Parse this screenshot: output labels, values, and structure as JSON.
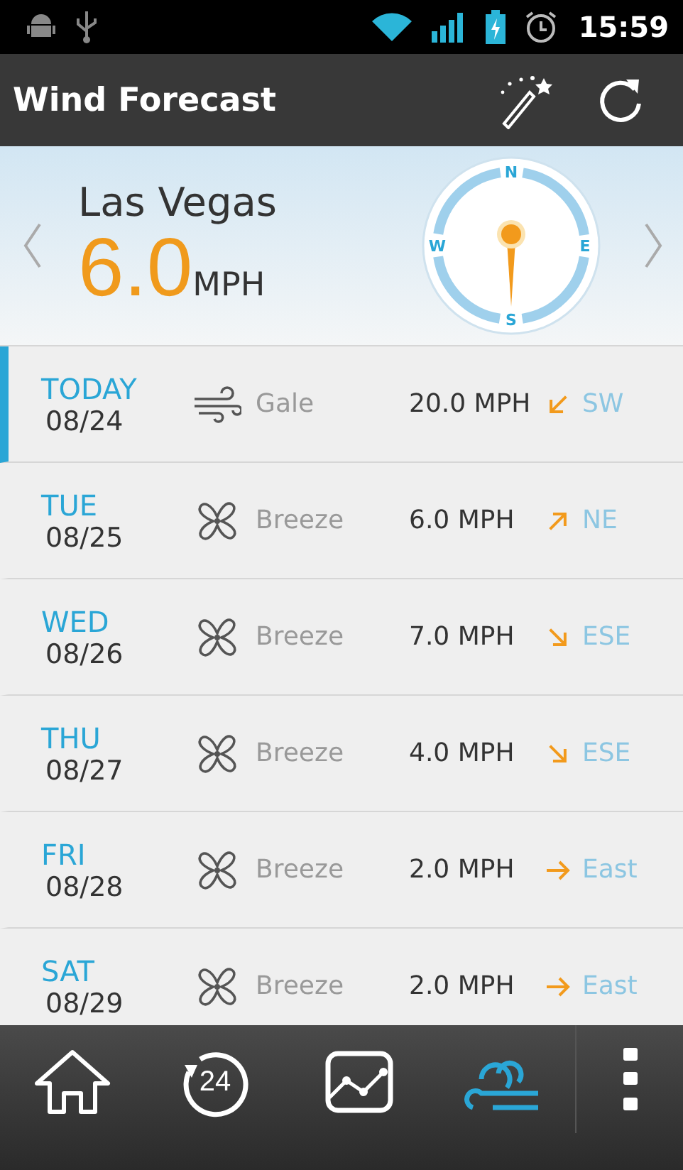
{
  "status_bar": {
    "time": "15:59"
  },
  "app_bar": {
    "title": "Wind Forecast"
  },
  "current": {
    "city": "Las Vegas",
    "speed": "6.0",
    "unit": "MPH",
    "compass": {
      "north": "N",
      "east": "E",
      "south": "S",
      "west": "W"
    }
  },
  "days": [
    {
      "day": "TODAY",
      "date": "08/24",
      "kind": "gale",
      "condition": "Gale",
      "speed": "20.0 MPH",
      "arrow": {
        "kind": "down-left"
      },
      "direction": "SW",
      "selected": true
    },
    {
      "day": "TUE",
      "date": "08/25",
      "kind": "breeze",
      "condition": "Breeze",
      "speed": "6.0 MPH",
      "arrow": {
        "kind": "up-right"
      },
      "direction": "NE",
      "selected": false
    },
    {
      "day": "WED",
      "date": "08/26",
      "kind": "breeze",
      "condition": "Breeze",
      "speed": "7.0 MPH",
      "arrow": {
        "kind": "down-right"
      },
      "direction": "ESE",
      "selected": false
    },
    {
      "day": "THU",
      "date": "08/27",
      "kind": "breeze",
      "condition": "Breeze",
      "speed": "4.0 MPH",
      "arrow": {
        "kind": "down-right"
      },
      "direction": "ESE",
      "selected": false
    },
    {
      "day": "FRI",
      "date": "08/28",
      "kind": "breeze",
      "condition": "Breeze",
      "speed": "2.0 MPH",
      "arrow": {
        "kind": "right"
      },
      "direction": "East",
      "selected": false
    },
    {
      "day": "SAT",
      "date": "08/29",
      "kind": "breeze",
      "condition": "Breeze",
      "speed": "2.0 MPH",
      "arrow": {
        "kind": "right"
      },
      "direction": "East",
      "selected": false
    }
  ],
  "nav": [
    {
      "kind": "home",
      "selected": false
    },
    {
      "kind": "history",
      "label": "24",
      "selected": false
    },
    {
      "kind": "chart",
      "selected": false
    },
    {
      "kind": "wind",
      "selected": true
    }
  ]
}
